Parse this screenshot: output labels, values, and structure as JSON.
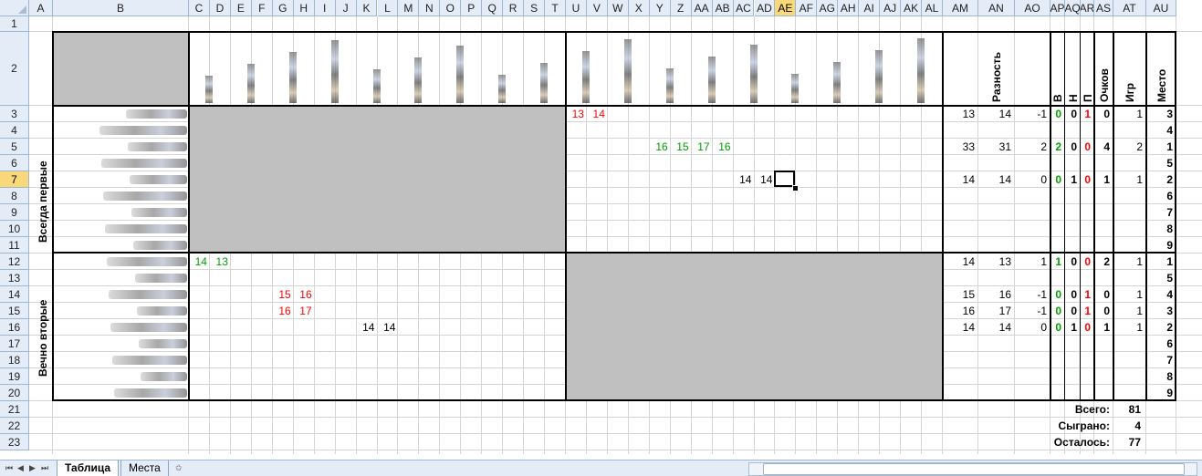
{
  "columns": [
    "A",
    "B",
    "C",
    "D",
    "E",
    "F",
    "G",
    "H",
    "I",
    "J",
    "K",
    "L",
    "M",
    "N",
    "O",
    "P",
    "Q",
    "R",
    "S",
    "T",
    "U",
    "V",
    "W",
    "X",
    "Y",
    "Z",
    "AA",
    "AB",
    "AC",
    "AD",
    "AE",
    "AF",
    "AG",
    "AH",
    "AI",
    "AJ",
    "AK",
    "AL",
    "AM",
    "AN",
    "AO",
    "AP",
    "AQ",
    "AR",
    "AS",
    "AT",
    "AU"
  ],
  "selected_column": "AE",
  "rows": [
    "1",
    "2",
    "3",
    "4",
    "5",
    "6",
    "7",
    "8",
    "9",
    "10",
    "11",
    "12",
    "13",
    "14",
    "15",
    "16",
    "17",
    "18",
    "19",
    "20",
    "21",
    "22",
    "23"
  ],
  "selected_row": "7",
  "stat_headers": {
    "diff": "Разность",
    "win": "В",
    "draw": "Н",
    "loss": "П",
    "points": "Очков",
    "games": "Игр",
    "place": "Место"
  },
  "groups": [
    "Всегда первые",
    "Вечно вторые"
  ],
  "match_scores": [
    {
      "cell": "U3",
      "value": "13",
      "color": "#ff0000"
    },
    {
      "cell": "V3",
      "value": "14",
      "color": "#ff0000"
    },
    {
      "cell": "Y5",
      "value": "16",
      "color": "#00a000"
    },
    {
      "cell": "Z5",
      "value": "15",
      "color": "#00a000"
    },
    {
      "cell": "AA5",
      "value": "17",
      "color": "#00a000"
    },
    {
      "cell": "AB5",
      "value": "16",
      "color": "#00a000"
    },
    {
      "cell": "AC7",
      "value": "14",
      "color": "#000000"
    },
    {
      "cell": "AD7",
      "value": "14",
      "color": "#000000"
    },
    {
      "cell": "C12",
      "value": "14",
      "color": "#00a000"
    },
    {
      "cell": "D12",
      "value": "13",
      "color": "#00a000"
    },
    {
      "cell": "G14",
      "value": "15",
      "color": "#ff0000"
    },
    {
      "cell": "H14",
      "value": "16",
      "color": "#ff0000"
    },
    {
      "cell": "G15",
      "value": "16",
      "color": "#ff0000"
    },
    {
      "cell": "H15",
      "value": "17",
      "color": "#ff0000"
    },
    {
      "cell": "K16",
      "value": "14",
      "color": "#000000"
    },
    {
      "cell": "L16",
      "value": "14",
      "color": "#000000"
    }
  ],
  "stats": [
    {
      "row": 3,
      "AM": "13",
      "AN": "14",
      "AO": "-1",
      "AP": "0",
      "AQ": "0",
      "AR": "1",
      "AS": "0",
      "AT": "1",
      "AU": "3"
    },
    {
      "row": 4,
      "AU": "4"
    },
    {
      "row": 5,
      "AM": "33",
      "AN": "31",
      "AO": "2",
      "AP": "2",
      "AQ": "0",
      "AR": "0",
      "AS": "4",
      "AT": "2",
      "AU": "1"
    },
    {
      "row": 6,
      "AU": "5"
    },
    {
      "row": 7,
      "AM": "14",
      "AN": "14",
      "AO": "0",
      "AP": "0",
      "AQ": "1",
      "AR": "0",
      "AS": "1",
      "AT": "1",
      "AU": "2"
    },
    {
      "row": 8,
      "AU": "6"
    },
    {
      "row": 9,
      "AU": "7"
    },
    {
      "row": 10,
      "AU": "8"
    },
    {
      "row": 11,
      "AU": "9"
    },
    {
      "row": 12,
      "AM": "14",
      "AN": "13",
      "AO": "1",
      "AP": "1",
      "AQ": "0",
      "AR": "0",
      "AS": "2",
      "AT": "1",
      "AU": "1"
    },
    {
      "row": 13,
      "AU": "5"
    },
    {
      "row": 14,
      "AM": "15",
      "AN": "16",
      "AO": "-1",
      "AP": "0",
      "AQ": "0",
      "AR": "1",
      "AS": "0",
      "AT": "1",
      "AU": "4"
    },
    {
      "row": 15,
      "AM": "16",
      "AN": "17",
      "AO": "-1",
      "AP": "0",
      "AQ": "0",
      "AR": "1",
      "AS": "0",
      "AT": "1",
      "AU": "3"
    },
    {
      "row": 16,
      "AM": "14",
      "AN": "14",
      "AO": "0",
      "AP": "0",
      "AQ": "1",
      "AR": "0",
      "AS": "1",
      "AT": "1",
      "AU": "2"
    },
    {
      "row": 17,
      "AU": "6"
    },
    {
      "row": 18,
      "AU": "7"
    },
    {
      "row": 19,
      "AU": "8"
    },
    {
      "row": 20,
      "AU": "9"
    }
  ],
  "summary": [
    {
      "label": "Всего:",
      "value": "81"
    },
    {
      "label": "Сыграно:",
      "value": "4"
    },
    {
      "label": "Осталось:",
      "value": "77"
    }
  ],
  "sheet_tabs": [
    {
      "label": "Таблица",
      "active": true
    },
    {
      "label": "Места",
      "active": false
    }
  ],
  "colors": {
    "win": "#00a000",
    "loss": "#ff0000",
    "filler": "#c0c0c0",
    "header_bg": "#e4ecf7",
    "selected_header": "#f8d878"
  }
}
